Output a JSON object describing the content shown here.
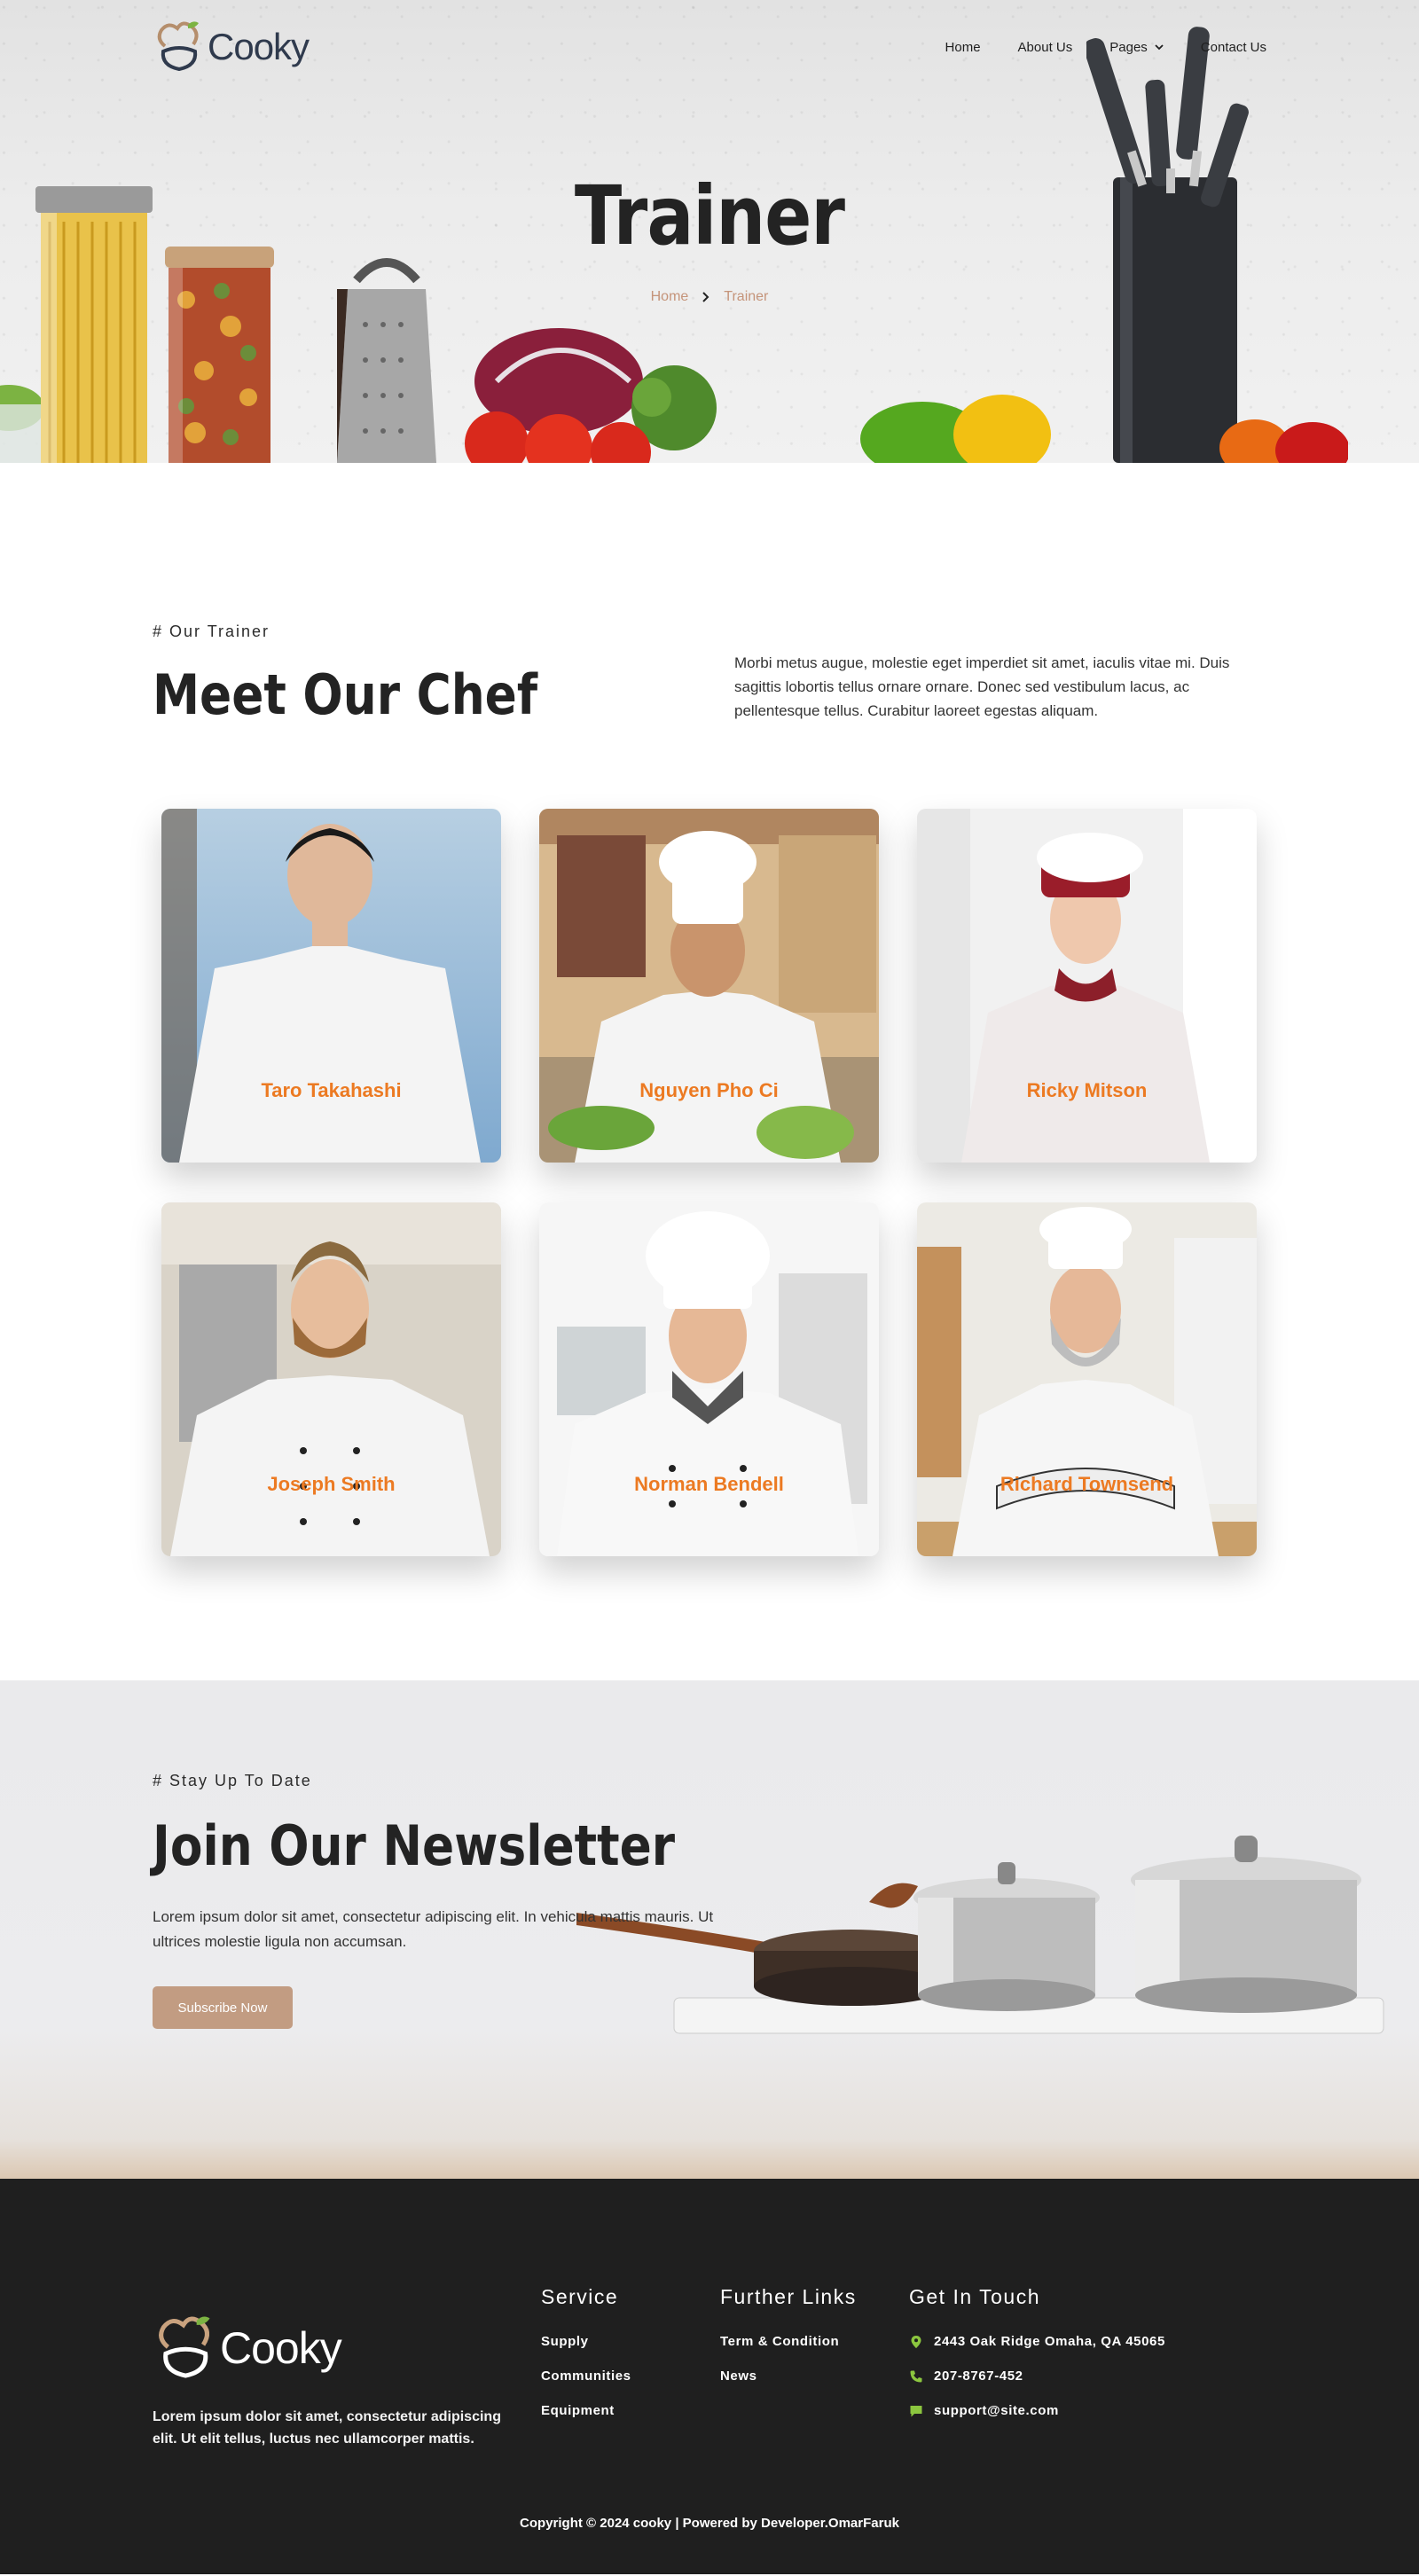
{
  "brand": {
    "name": "Cooky"
  },
  "nav": {
    "items": [
      {
        "label": "Home"
      },
      {
        "label": "About Us"
      },
      {
        "label": "Pages"
      },
      {
        "label": "Contact Us"
      }
    ]
  },
  "hero": {
    "title": "Trainer",
    "breadcrumb": {
      "home": "Home",
      "current": "Trainer"
    }
  },
  "team": {
    "eyebrow": "# Our Trainer",
    "title": "Meet Our Chef",
    "description": "Morbi metus augue, molestie eget imperdiet sit amet, iaculis vitae mi. Duis sagittis lobortis tellus ornare ornare. Donec sed vestibulum lacus, ac pellentesque tellus. Curabitur laoreet egestas aliquam.",
    "chefs": [
      {
        "name": "Taro Takahashi"
      },
      {
        "name": "Nguyen Pho Ci"
      },
      {
        "name": "Ricky Mitson"
      },
      {
        "name": "Joseph Smith"
      },
      {
        "name": "Norman Bendell"
      },
      {
        "name": "Richard Townsend"
      }
    ]
  },
  "newsletter": {
    "eyebrow": "# Stay Up To Date",
    "title": "Join Our Newsletter",
    "text": "Lorem ipsum dolor sit amet, consectetur adipiscing elit. In vehicula mattis mauris. Ut ultrices molestie ligula non accumsan.",
    "button_label": "Subscribe Now"
  },
  "footer": {
    "about": "Lorem ipsum dolor sit amet, consectetur adipiscing elit. Ut elit tellus, luctus nec ullamcorper mattis.",
    "service": {
      "title": "Service",
      "items": [
        "Supply",
        "Communities",
        "Equipment"
      ]
    },
    "links": {
      "title": "Further Links",
      "items": [
        "Term & Condition",
        "News"
      ]
    },
    "contact": {
      "title": "Get In Touch",
      "address": "2443 Oak Ridge Omaha, QA 45065",
      "phone": "207-8767-452",
      "email": "support@site.com"
    },
    "copyright": "Copyright © 2024 cooky | Powered by Developer.OmarFaruk"
  },
  "colors": {
    "accent": "#ec7a22",
    "button": "#c29c82",
    "breadcrumb": "#c5947a",
    "footer_bg": "#1f1f1f",
    "icon_green": "#8cc63f"
  }
}
